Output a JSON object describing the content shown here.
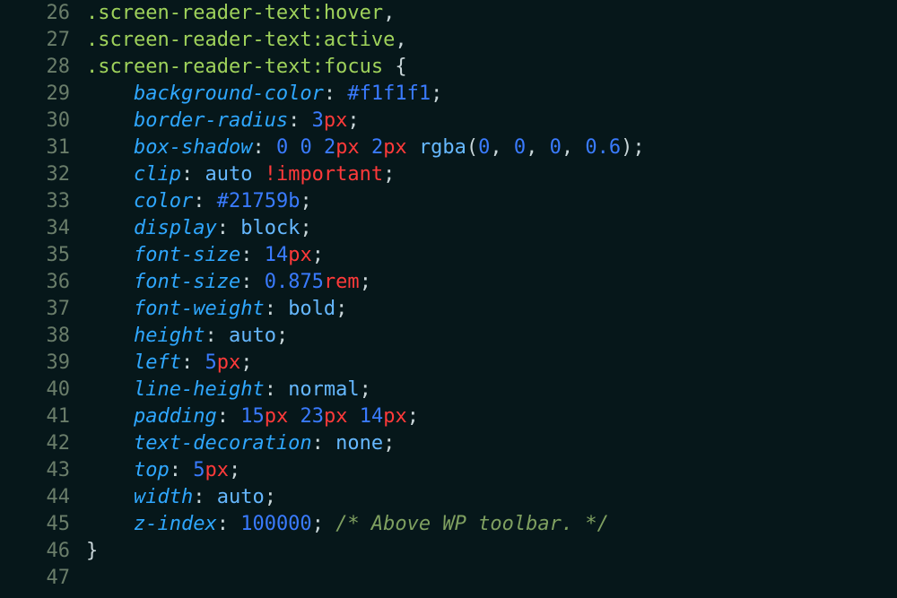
{
  "editor": {
    "first_line_number": 26,
    "lines": [
      {
        "indent": 0,
        "tokens": [
          {
            "t": "selector",
            "v": ".screen-reader-text"
          },
          {
            "t": "pseudo",
            "v": ":hover"
          },
          {
            "t": "punct",
            "v": ","
          }
        ]
      },
      {
        "indent": 0,
        "tokens": [
          {
            "t": "selector",
            "v": ".screen-reader-text"
          },
          {
            "t": "pseudo",
            "v": ":active"
          },
          {
            "t": "punct",
            "v": ","
          }
        ]
      },
      {
        "indent": 0,
        "tokens": [
          {
            "t": "selector",
            "v": ".screen-reader-text"
          },
          {
            "t": "pseudo",
            "v": ":focus"
          },
          {
            "t": "punct",
            "v": " "
          },
          {
            "t": "brace",
            "v": "{"
          }
        ]
      },
      {
        "indent": 1,
        "tokens": [
          {
            "t": "prop",
            "v": "background-color"
          },
          {
            "t": "punct",
            "v": ": "
          },
          {
            "t": "hex",
            "v": "#f1f1f1"
          },
          {
            "t": "semi",
            "v": ";"
          }
        ]
      },
      {
        "indent": 1,
        "tokens": [
          {
            "t": "prop",
            "v": "border-radius"
          },
          {
            "t": "punct",
            "v": ": "
          },
          {
            "t": "num",
            "v": "3"
          },
          {
            "t": "unit",
            "v": "px"
          },
          {
            "t": "semi",
            "v": ";"
          }
        ]
      },
      {
        "indent": 1,
        "tokens": [
          {
            "t": "prop",
            "v": "box-shadow"
          },
          {
            "t": "punct",
            "v": ": "
          },
          {
            "t": "num",
            "v": "0"
          },
          {
            "t": "punct",
            "v": " "
          },
          {
            "t": "num",
            "v": "0"
          },
          {
            "t": "punct",
            "v": " "
          },
          {
            "t": "num",
            "v": "2"
          },
          {
            "t": "unit",
            "v": "px"
          },
          {
            "t": "punct",
            "v": " "
          },
          {
            "t": "num",
            "v": "2"
          },
          {
            "t": "unit",
            "v": "px"
          },
          {
            "t": "punct",
            "v": " "
          },
          {
            "t": "fn",
            "v": "rgba"
          },
          {
            "t": "punct",
            "v": "("
          },
          {
            "t": "num",
            "v": "0"
          },
          {
            "t": "punct",
            "v": ", "
          },
          {
            "t": "num",
            "v": "0"
          },
          {
            "t": "punct",
            "v": ", "
          },
          {
            "t": "num",
            "v": "0"
          },
          {
            "t": "punct",
            "v": ", "
          },
          {
            "t": "num",
            "v": "0.6"
          },
          {
            "t": "punct",
            "v": ")"
          },
          {
            "t": "semi",
            "v": ";"
          }
        ]
      },
      {
        "indent": 1,
        "tokens": [
          {
            "t": "prop",
            "v": "clip"
          },
          {
            "t": "punct",
            "v": ": "
          },
          {
            "t": "value-txt",
            "v": "auto"
          },
          {
            "t": "punct",
            "v": " "
          },
          {
            "t": "important",
            "v": "!important"
          },
          {
            "t": "semi",
            "v": ";"
          }
        ]
      },
      {
        "indent": 1,
        "tokens": [
          {
            "t": "prop",
            "v": "color"
          },
          {
            "t": "punct",
            "v": ": "
          },
          {
            "t": "hex",
            "v": "#21759b"
          },
          {
            "t": "semi",
            "v": ";"
          }
        ]
      },
      {
        "indent": 1,
        "tokens": [
          {
            "t": "prop",
            "v": "display"
          },
          {
            "t": "punct",
            "v": ": "
          },
          {
            "t": "value-txt",
            "v": "block"
          },
          {
            "t": "semi",
            "v": ";"
          }
        ]
      },
      {
        "indent": 1,
        "tokens": [
          {
            "t": "prop",
            "v": "font-size"
          },
          {
            "t": "punct",
            "v": ": "
          },
          {
            "t": "num",
            "v": "14"
          },
          {
            "t": "unit",
            "v": "px"
          },
          {
            "t": "semi",
            "v": ";"
          }
        ]
      },
      {
        "indent": 1,
        "tokens": [
          {
            "t": "prop",
            "v": "font-size"
          },
          {
            "t": "punct",
            "v": ": "
          },
          {
            "t": "num",
            "v": "0.875"
          },
          {
            "t": "unit",
            "v": "rem"
          },
          {
            "t": "semi",
            "v": ";"
          }
        ]
      },
      {
        "indent": 1,
        "tokens": [
          {
            "t": "prop",
            "v": "font-weight"
          },
          {
            "t": "punct",
            "v": ": "
          },
          {
            "t": "value-txt",
            "v": "bold"
          },
          {
            "t": "semi",
            "v": ";"
          }
        ]
      },
      {
        "indent": 1,
        "tokens": [
          {
            "t": "prop",
            "v": "height"
          },
          {
            "t": "punct",
            "v": ": "
          },
          {
            "t": "value-txt",
            "v": "auto"
          },
          {
            "t": "semi",
            "v": ";"
          }
        ]
      },
      {
        "indent": 1,
        "tokens": [
          {
            "t": "prop",
            "v": "left"
          },
          {
            "t": "punct",
            "v": ": "
          },
          {
            "t": "num",
            "v": "5"
          },
          {
            "t": "unit",
            "v": "px"
          },
          {
            "t": "semi",
            "v": ";"
          }
        ]
      },
      {
        "indent": 1,
        "tokens": [
          {
            "t": "prop",
            "v": "line-height"
          },
          {
            "t": "punct",
            "v": ": "
          },
          {
            "t": "value-txt",
            "v": "normal"
          },
          {
            "t": "semi",
            "v": ";"
          }
        ]
      },
      {
        "indent": 1,
        "tokens": [
          {
            "t": "prop",
            "v": "padding"
          },
          {
            "t": "punct",
            "v": ": "
          },
          {
            "t": "num",
            "v": "15"
          },
          {
            "t": "unit",
            "v": "px"
          },
          {
            "t": "punct",
            "v": " "
          },
          {
            "t": "num",
            "v": "23"
          },
          {
            "t": "unit",
            "v": "px"
          },
          {
            "t": "punct",
            "v": " "
          },
          {
            "t": "num",
            "v": "14"
          },
          {
            "t": "unit",
            "v": "px"
          },
          {
            "t": "semi",
            "v": ";"
          }
        ]
      },
      {
        "indent": 1,
        "tokens": [
          {
            "t": "prop",
            "v": "text-decoration"
          },
          {
            "t": "punct",
            "v": ": "
          },
          {
            "t": "value-txt",
            "v": "none"
          },
          {
            "t": "semi",
            "v": ";"
          }
        ]
      },
      {
        "indent": 1,
        "tokens": [
          {
            "t": "prop",
            "v": "top"
          },
          {
            "t": "punct",
            "v": ": "
          },
          {
            "t": "num",
            "v": "5"
          },
          {
            "t": "unit",
            "v": "px"
          },
          {
            "t": "semi",
            "v": ";"
          }
        ]
      },
      {
        "indent": 1,
        "tokens": [
          {
            "t": "prop",
            "v": "width"
          },
          {
            "t": "punct",
            "v": ": "
          },
          {
            "t": "value-txt",
            "v": "auto"
          },
          {
            "t": "semi",
            "v": ";"
          }
        ]
      },
      {
        "indent": 1,
        "tokens": [
          {
            "t": "prop",
            "v": "z-index"
          },
          {
            "t": "punct",
            "v": ": "
          },
          {
            "t": "num",
            "v": "100000"
          },
          {
            "t": "semi",
            "v": ";"
          },
          {
            "t": "punct",
            "v": " "
          },
          {
            "t": "comment",
            "v": "/* Above WP toolbar. */"
          }
        ]
      },
      {
        "indent": 0,
        "tokens": [
          {
            "t": "brace",
            "v": "}"
          }
        ]
      },
      {
        "indent": 0,
        "tokens": []
      }
    ]
  }
}
